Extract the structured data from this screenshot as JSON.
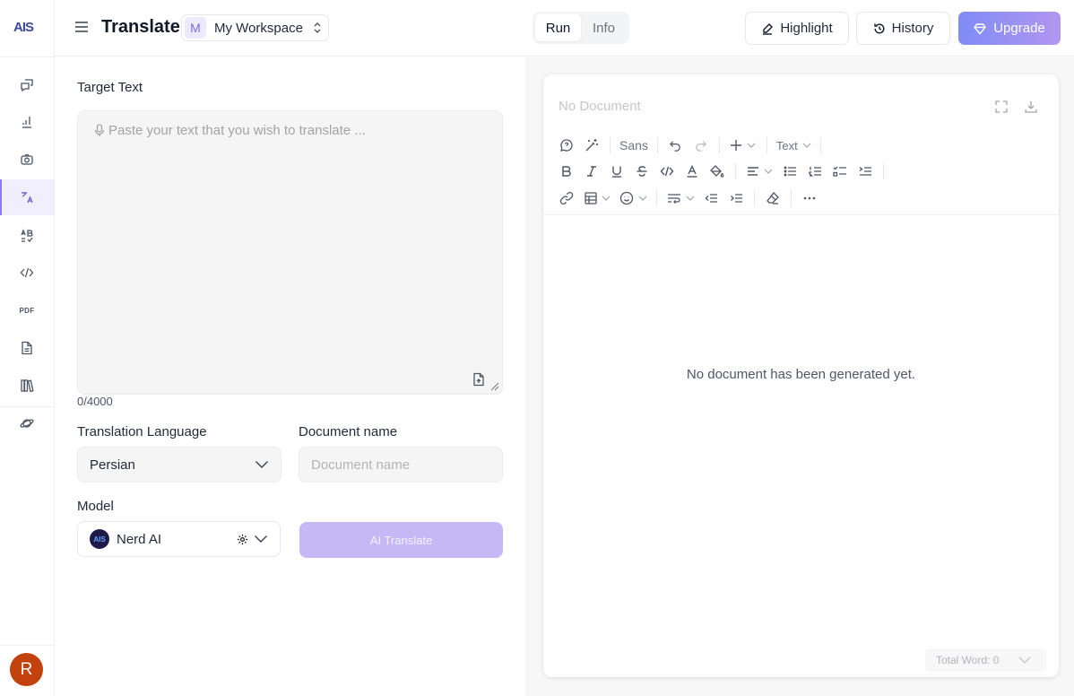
{
  "app": {
    "logo_text": "AIS",
    "page_title": "Translate",
    "workspace": {
      "badge": "M",
      "name": "My Workspace"
    },
    "mode_tabs": [
      {
        "label": "Run",
        "active": true
      },
      {
        "label": "Info",
        "active": false
      }
    ],
    "header_buttons": {
      "highlight": "Highlight",
      "history": "History",
      "upgrade": "Upgrade"
    },
    "accent_color": "#8b7cf6"
  },
  "sidebar": {
    "items": [
      {
        "icon": "chat-icon"
      },
      {
        "icon": "writing-icon"
      },
      {
        "icon": "camera-icon"
      },
      {
        "icon": "translate-icon",
        "active": true
      },
      {
        "icon": "grammar-check-icon"
      },
      {
        "icon": "code-icon"
      },
      {
        "icon": "pdf-icon",
        "label": "PDF"
      },
      {
        "icon": "document-icon"
      },
      {
        "icon": "library-icon"
      },
      {
        "icon": "planet-icon"
      }
    ],
    "user_initial": "R"
  },
  "form": {
    "target_text_label": "Target Text",
    "target_text_placeholder": "Paste your text that you wish to translate ...",
    "char_counter": "0/4000",
    "language_label": "Translation Language",
    "language_value": "Persian",
    "doc_name_label": "Document name",
    "doc_name_placeholder": "Document name",
    "model_label": "Model",
    "model_logo": "AIS",
    "model_value": "Nerd AI",
    "submit_label": "AI Translate"
  },
  "document": {
    "title_placeholder": "No Document",
    "toolbar": {
      "font_label": "Sans",
      "block_type_label": "Text"
    },
    "empty_message": "No document has been generated yet.",
    "word_count": "Total Word: 0"
  }
}
